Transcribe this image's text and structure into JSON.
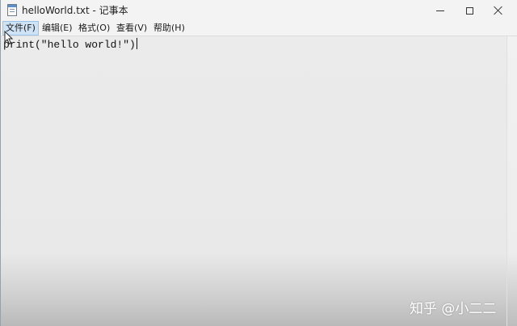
{
  "window": {
    "title": "helloWorld.txt - 记事本"
  },
  "menu": {
    "items": [
      {
        "label": "文件(F)"
      },
      {
        "label": "编辑(E)"
      },
      {
        "label": "格式(O)"
      },
      {
        "label": "查看(V)"
      },
      {
        "label": "帮助(H)"
      }
    ]
  },
  "editor": {
    "content": "print(\"hello world!\")"
  },
  "icons": {
    "app": "notepad-icon",
    "minimize": "minimize-icon",
    "maximize": "maximize-icon",
    "close": "close-icon",
    "cursor": "mouse-cursor-icon"
  },
  "watermark": {
    "text": "知乎 @小二二"
  }
}
